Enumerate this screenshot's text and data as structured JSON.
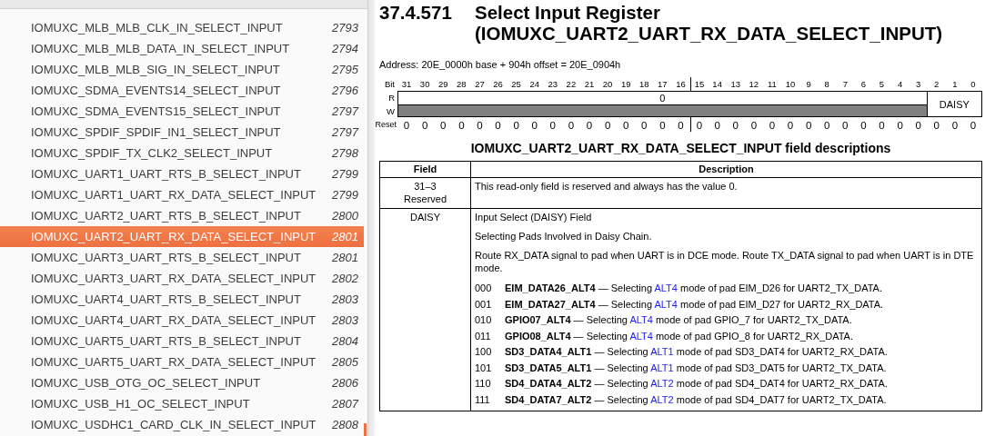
{
  "sidebar": {
    "items": [
      {
        "title": "IOMUXC_MLB_MLB_CLK_IN_SELECT_INPUT",
        "page": "2793",
        "selected": false
      },
      {
        "title": "IOMUXC_MLB_MLB_DATA_IN_SELECT_INPUT",
        "page": "2794",
        "selected": false
      },
      {
        "title": "IOMUXC_MLB_MLB_SIG_IN_SELECT_INPUT",
        "page": "2795",
        "selected": false
      },
      {
        "title": "IOMUXC_SDMA_EVENTS14_SELECT_INPUT",
        "page": "2796",
        "selected": false
      },
      {
        "title": "IOMUXC_SDMA_EVENTS15_SELECT_INPUT",
        "page": "2797",
        "selected": false
      },
      {
        "title": "IOMUXC_SPDIF_SPDIF_IN1_SELECT_INPUT",
        "page": "2797",
        "selected": false
      },
      {
        "title": "IOMUXC_SPDIF_TX_CLK2_SELECT_INPUT",
        "page": "2798",
        "selected": false
      },
      {
        "title": "IOMUXC_UART1_UART_RTS_B_SELECT_INPUT",
        "page": "2799",
        "selected": false
      },
      {
        "title": "IOMUXC_UART1_UART_RX_DATA_SELECT_INPUT",
        "page": "2799",
        "selected": false
      },
      {
        "title": "IOMUXC_UART2_UART_RTS_B_SELECT_INPUT",
        "page": "2800",
        "selected": false
      },
      {
        "title": "IOMUXC_UART2_UART_RX_DATA_SELECT_INPUT",
        "page": "2801",
        "selected": true
      },
      {
        "title": "IOMUXC_UART3_UART_RTS_B_SELECT_INPUT",
        "page": "2801",
        "selected": false
      },
      {
        "title": "IOMUXC_UART3_UART_RX_DATA_SELECT_INPUT",
        "page": "2802",
        "selected": false
      },
      {
        "title": "IOMUXC_UART4_UART_RTS_B_SELECT_INPUT",
        "page": "2803",
        "selected": false
      },
      {
        "title": "IOMUXC_UART4_UART_RX_DATA_SELECT_INPUT",
        "page": "2803",
        "selected": false
      },
      {
        "title": "IOMUXC_UART5_UART_RTS_B_SELECT_INPUT",
        "page": "2804",
        "selected": false
      },
      {
        "title": "IOMUXC_UART5_UART_RX_DATA_SELECT_INPUT",
        "page": "2805",
        "selected": false
      },
      {
        "title": "IOMUXC_USB_OTG_OC_SELECT_INPUT",
        "page": "2806",
        "selected": false
      },
      {
        "title": "IOMUXC_USB_H1_OC_SELECT_INPUT",
        "page": "2807",
        "selected": false
      },
      {
        "title": "IOMUXC_USDHC1_CARD_CLK_IN_SELECT_INPUT",
        "page": "2808",
        "selected": false
      }
    ]
  },
  "section": {
    "number": "37.4.571",
    "title_lines": [
      "Select Input Register",
      "(IOMUXC_UART2_UART_RX_DATA_SELECT_INPUT)"
    ]
  },
  "address": "Address: 20E_0000h base + 904h offset = 20E_0904h",
  "register": {
    "bit_label": "Bit",
    "bits": [
      "31",
      "30",
      "29",
      "28",
      "27",
      "26",
      "25",
      "24",
      "23",
      "22",
      "21",
      "20",
      "19",
      "18",
      "17",
      "16",
      "15",
      "14",
      "13",
      "12",
      "11",
      "10",
      "9",
      "8",
      "7",
      "6",
      "5",
      "4",
      "3",
      "2",
      "1",
      "0"
    ],
    "read_label": "R",
    "write_label": "W",
    "reserved_value": "0",
    "field_name": "DAISY",
    "reset_label": "Reset",
    "reset_values": [
      "0",
      "0",
      "0",
      "0",
      "0",
      "0",
      "0",
      "0",
      "0",
      "0",
      "0",
      "0",
      "0",
      "0",
      "0",
      "0",
      "0",
      "0",
      "0",
      "0",
      "0",
      "0",
      "0",
      "0",
      "0",
      "0",
      "0",
      "0",
      "0",
      "0",
      "0",
      "0"
    ]
  },
  "table": {
    "caption": "IOMUXC_UART2_UART_RX_DATA_SELECT_INPUT field descriptions",
    "columns": [
      "Field",
      "Description"
    ],
    "rows": [
      {
        "field_lines": [
          "31–3",
          "Reserved"
        ],
        "paragraphs": [
          "This read-only field is reserved and always has the value 0."
        ]
      },
      {
        "field_lines": [
          "DAISY"
        ],
        "paragraphs": [
          "Input Select (DAISY) Field",
          "Selecting Pads Involved in Daisy Chain.",
          "Route RX_DATA signal to pad when UART is in DCE mode. Route TX_DATA signal to pad when UART is in DTE mode."
        ],
        "options": [
          {
            "code": "000",
            "before": "**EIM_DATA26_ALT4** — Selecting",
            "link": "ALT4",
            "after": "mode of pad EIM_D26 for UART2_TX_DATA."
          },
          {
            "code": "001",
            "before": "**EIM_DATA27_ALT4** — Selecting",
            "link": "ALT4",
            "after": "mode of pad EIM_D27 for UART2_RX_DATA."
          },
          {
            "code": "010",
            "before": "**GPIO07_ALT4** — Selecting",
            "link": "ALT4",
            "after": "mode of pad GPIO_7 for UART2_TX_DATA."
          },
          {
            "code": "011",
            "before": "**GPIO08_ALT4** — Selecting",
            "link": "ALT4",
            "after": "mode of pad GPIO_8 for UART2_RX_DATA."
          },
          {
            "code": "100",
            "before": "**SD3_DATA4_ALT1** — Selecting",
            "link": "ALT1",
            "after": "mode of pad SD3_DAT4 for UART2_RX_DATA."
          },
          {
            "code": "101",
            "before": "**SD3_DATA5_ALT1** — Selecting",
            "link": "ALT1",
            "after": "mode of pad SD3_DAT5 for UART2_TX_DATA."
          },
          {
            "code": "110",
            "before": "**SD4_DATA4_ALT2** — Selecting",
            "link": "ALT2",
            "after": "mode of pad SD4_DAT4 for UART2_RX_DATA."
          },
          {
            "code": "111",
            "before": "**SD4_DATA7_ALT2** — Selecting",
            "link": "ALT2",
            "after": "mode of pad SD4_DAT7 for UART2_TX_DATA."
          }
        ]
      }
    ]
  }
}
